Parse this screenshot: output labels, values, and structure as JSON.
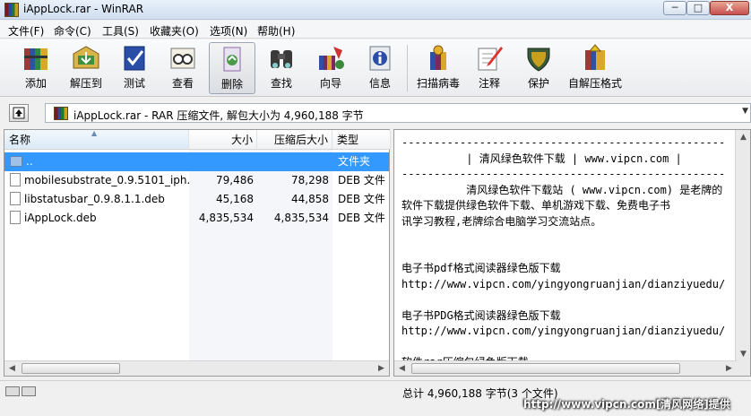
{
  "window": {
    "title": "iAppLock.rar - WinRAR",
    "min_label": "─",
    "max_label": "□",
    "close_label": "X"
  },
  "menu": [
    "文件(F)",
    "命令(C)",
    "工具(S)",
    "收藏夹(O)",
    "选项(N)",
    "帮助(H)"
  ],
  "toolbar": {
    "add": "添加",
    "extract_to": "解压到",
    "test": "测试",
    "view": "查看",
    "delete": "删除",
    "find": "查找",
    "wizard": "向导",
    "info": "信息",
    "virus_scan": "扫描病毒",
    "comment": "注释",
    "protect": "保护",
    "sfx": "自解压格式"
  },
  "address": {
    "path": "iAppLock.rar - RAR 压缩文件, 解包大小为 4,960,188 字节"
  },
  "columns": {
    "name": "名称",
    "size": "大小",
    "packed": "压缩后大小",
    "type": "类型"
  },
  "files": [
    {
      "name": "..",
      "size": "",
      "packed": "",
      "type": "文件夹",
      "folder": true
    },
    {
      "name": "mobilesubstrate_0.9.5101_iph...",
      "size": "79,486",
      "packed": "78,298",
      "type": "DEB 文件"
    },
    {
      "name": "libstatusbar_0.9.8.1.1.deb",
      "size": "45,168",
      "packed": "44,858",
      "type": "DEB 文件"
    },
    {
      "name": "iAppLock.deb",
      "size": "4,835,534",
      "packed": "4,835,534",
      "type": "DEB 文件"
    }
  ],
  "comment": {
    "text": "--------------------------------------------------\n          | 清风绿色软件下载 | www.vipcn.com |\n--------------------------------------------------\n          清风绿色软件下载站 ( www.vipcn.com) 是老牌的\n软件下载提供绿色软件下载、单机游戏下载、免费电子书\n讯学习教程,老牌综合电脑学习交流站点。\n\n\n电子书pdf格式阅读器绿色版下载\nhttp://www.vipcn.com/yingyongruanjian/dianziyuedu/\n\n电子书PDG格式阅读器绿色版下载\nhttp://www.vipcn.com/yingyongruanjian/dianziyuedu/\n\n软件rar压缩包绿色版下载"
  },
  "status": {
    "selection": "",
    "total": "总计 4,960,188 字节(3 个文件)",
    "watermark": "http://www.vipcn.com[清风网络]提供"
  }
}
